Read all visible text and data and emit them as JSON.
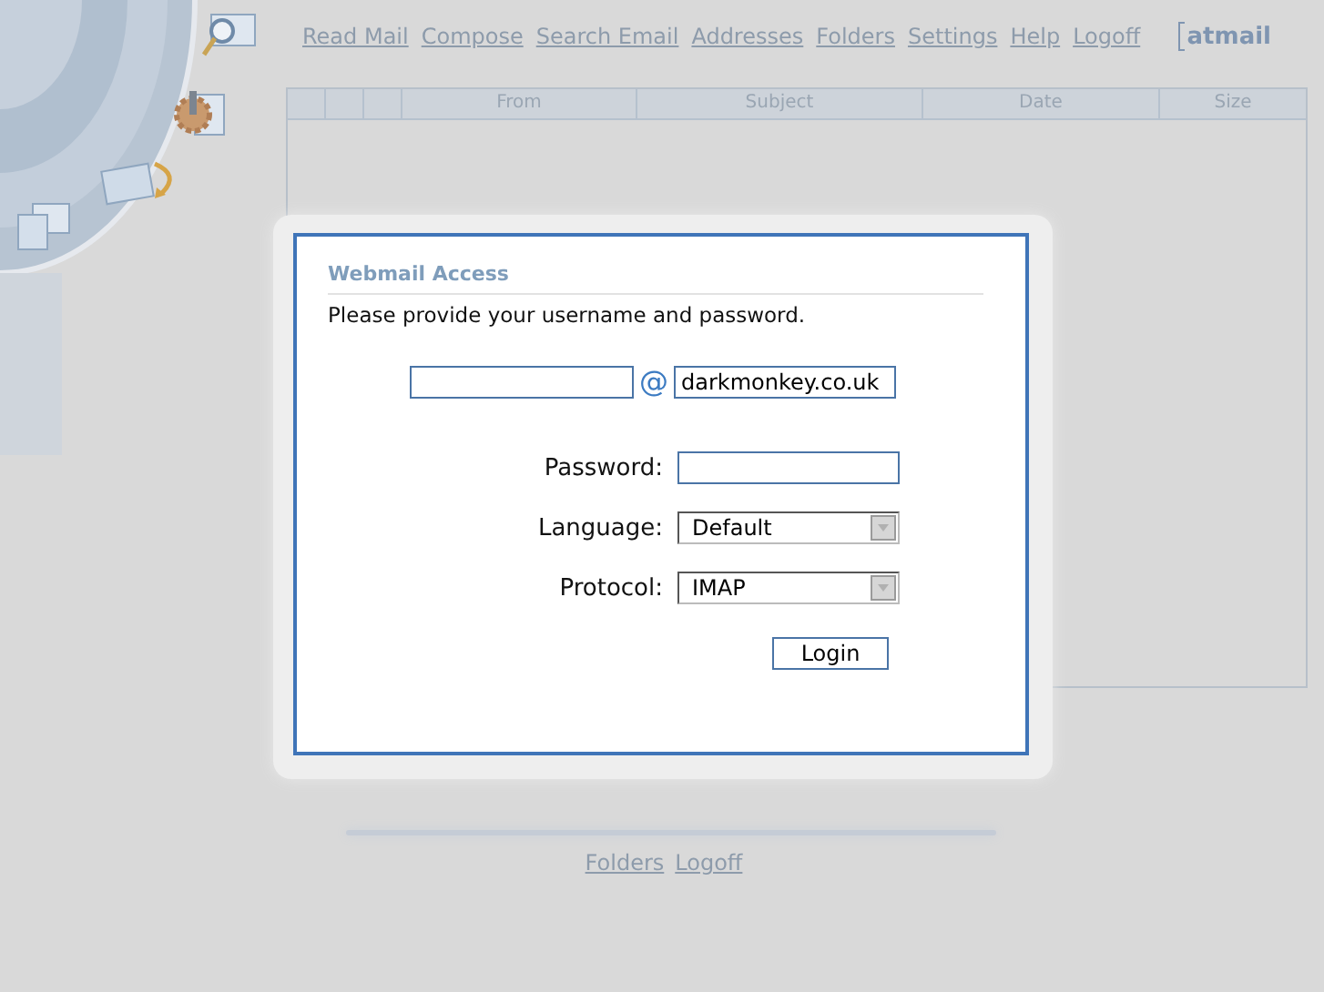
{
  "nav": {
    "links": [
      "Read Mail",
      "Compose",
      "Search Email",
      "Addresses",
      "Folders",
      "Settings",
      "Help",
      "Logoff"
    ],
    "logo": "atmail"
  },
  "message_table": {
    "columns": [
      {
        "label": "From"
      },
      {
        "label": "Subject"
      },
      {
        "label": "Date"
      },
      {
        "label": "Size"
      }
    ]
  },
  "login_dialog": {
    "title": "Webmail Access",
    "prompt": "Please provide your username and password.",
    "at_sign": "@",
    "domain": {
      "value": "darkmonkey.co.uk"
    },
    "fields": [
      {
        "label": "Password:",
        "kind": "password"
      },
      {
        "label": "Language:",
        "kind": "select",
        "value": "Default"
      },
      {
        "label": "Protocol:",
        "kind": "select",
        "value": "IMAP"
      }
    ],
    "button": "Login"
  },
  "footer": {
    "links": [
      "Folders",
      "Logoff"
    ]
  }
}
